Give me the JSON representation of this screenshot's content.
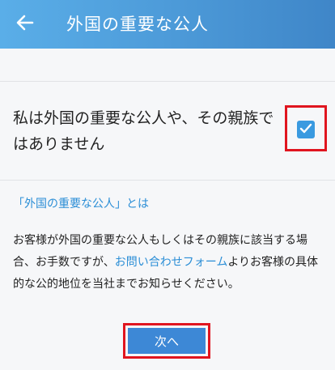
{
  "header": {
    "title": "外国の重要な公人",
    "back_icon": "arrow-left-icon"
  },
  "confirmation": {
    "label": "私は外国の重要な公人や、その親族ではありません",
    "checked": true,
    "check_icon": "checkmark-icon"
  },
  "info_link": "「外国の重要な公人」とは",
  "notice": {
    "text_before": "お客様が外国の重要な公人もしくはその親族に該当する場合、お手数ですが、",
    "link_text": "お問い合わせフォーム",
    "text_after": "よりお客様の具体的な公的地位を当社までお知らせください。"
  },
  "next_button_label": "次へ",
  "colors": {
    "accent": "#3d88d6",
    "link": "#2b8ed6",
    "highlight": "#e0151f"
  }
}
